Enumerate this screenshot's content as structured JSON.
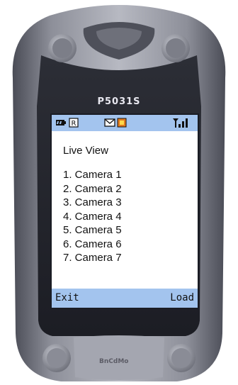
{
  "device": {
    "model": "P5031S",
    "brand_logo": "BnCdMo"
  },
  "status_bar": {
    "indicators": [
      "battery-icon",
      "r-badge-icon",
      "envelope-icon",
      "notification-icon",
      "signal-icon"
    ],
    "colors": {
      "bar": "#a3c4ee",
      "notification": "#e07a1f"
    }
  },
  "screen": {
    "title": "Live View",
    "items": [
      {
        "label": "1.  Camera 1"
      },
      {
        "label": "2.  Camera 2"
      },
      {
        "label": "3.  Camera 3"
      },
      {
        "label": "4.  Camera 4"
      },
      {
        "label": "5.  Camera 5"
      },
      {
        "label": "6.  Camera 6"
      },
      {
        "label": "7.  Camera 7"
      }
    ]
  },
  "softkeys": {
    "left": "Exit",
    "right": "Load"
  }
}
